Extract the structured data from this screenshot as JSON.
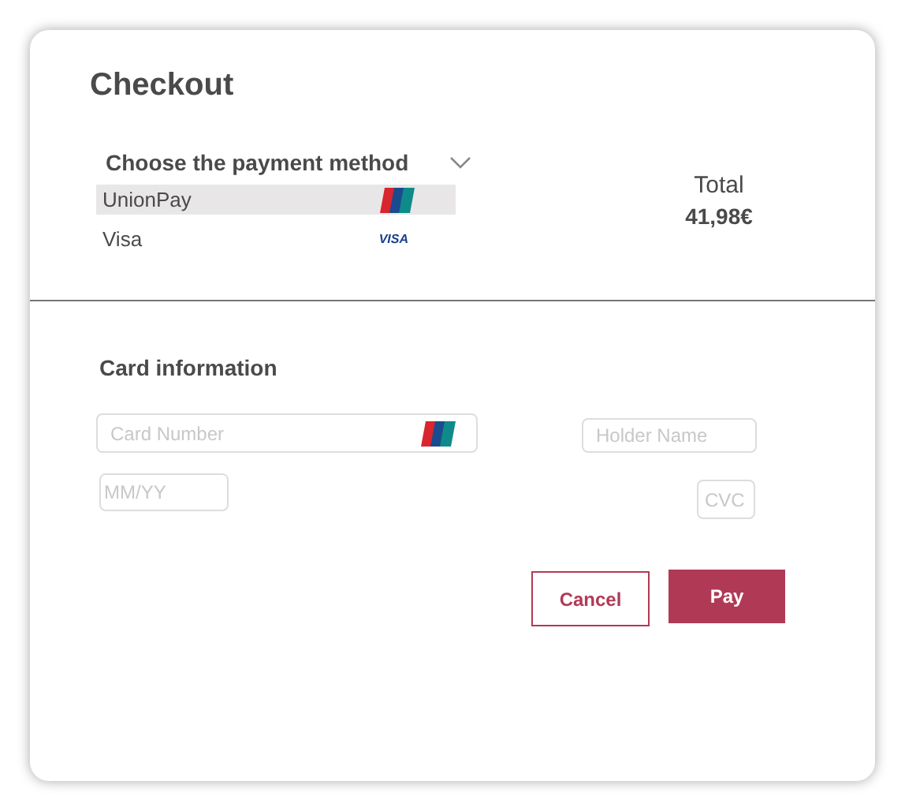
{
  "title": "Checkout",
  "payment": {
    "heading": "Choose the payment method",
    "expanded": true,
    "methods": [
      {
        "name": "UnionPay",
        "kind": "unionpay",
        "selected": true
      },
      {
        "name": "Visa",
        "kind": "visa",
        "logo_text": "VISA",
        "selected": false
      }
    ]
  },
  "total": {
    "label": "Total",
    "amount": "41,98€"
  },
  "card": {
    "heading": "Card information",
    "card_number": {
      "placeholder": "Card Number"
    },
    "holder_name": {
      "placeholder": "Holder Name"
    },
    "expiry": {
      "placeholder": "MM/YY"
    },
    "cvc": {
      "placeholder": "CVC"
    }
  },
  "buttons": {
    "cancel": "Cancel",
    "pay": "Pay"
  }
}
